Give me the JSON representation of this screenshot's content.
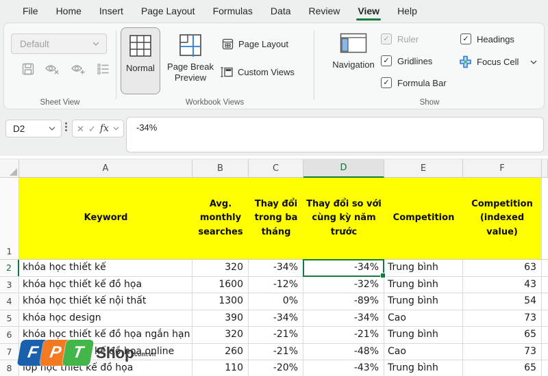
{
  "tabs": [
    {
      "label": "File"
    },
    {
      "label": "Home"
    },
    {
      "label": "Insert"
    },
    {
      "label": "Page Layout"
    },
    {
      "label": "Formulas"
    },
    {
      "label": "Data"
    },
    {
      "label": "Review"
    },
    {
      "label": "View"
    },
    {
      "label": "Help"
    }
  ],
  "active_tab": "View",
  "ribbon": {
    "sheet_view": {
      "label": "Sheet View",
      "dropdown_value": "Default"
    },
    "workbook_views": {
      "label": "Workbook Views",
      "normal": "Normal",
      "page_break_preview": "Page Break Preview",
      "page_layout": "Page Layout",
      "custom_views": "Custom Views"
    },
    "navigation": {
      "label": "Navigation"
    },
    "show": {
      "label": "Show",
      "ruler": "Ruler",
      "gridlines": "Gridlines",
      "formula_bar": "Formula Bar",
      "headings": "Headings",
      "focus_cell": "Focus Cell"
    }
  },
  "formula_bar": {
    "name_box": "D2",
    "value": "-34%"
  },
  "icons": {
    "cancel": "✕",
    "check": "✓",
    "fx": "fx"
  },
  "sheet": {
    "column_letters": [
      "A",
      "B",
      "C",
      "D",
      "E",
      "F"
    ],
    "selected_cell": "D2",
    "selected_column": "D",
    "selected_row": 2,
    "header_fill_color": "#FFFF00",
    "accent_color": "#107C41",
    "headers": [
      "Keyword",
      "Avg. monthly searches",
      "Thay đổi trong ba tháng",
      "Thay đổi so với cùng kỳ năm trước",
      "Competition",
      "Competition (indexed value)"
    ],
    "rows": [
      {
        "num": 2,
        "cells": [
          "khóa học thiết kế",
          "320",
          "-34%",
          "-34%",
          "Trung bình",
          "63"
        ]
      },
      {
        "num": 3,
        "cells": [
          "khóa học thiết kế đồ họa",
          "1600",
          "-12%",
          "-32%",
          "Trung bình",
          "43"
        ]
      },
      {
        "num": 4,
        "cells": [
          "khóa học thiết kế nội thất",
          "1300",
          "0%",
          "-89%",
          "Trung bình",
          "54"
        ]
      },
      {
        "num": 5,
        "cells": [
          "khóa học design",
          "390",
          "-34%",
          "-34%",
          "Cao",
          "73"
        ]
      },
      {
        "num": 6,
        "cells": [
          "khóa học thiết kế đồ họa ngắn hạn",
          "320",
          "-21%",
          "-21%",
          "Trung bình",
          "65"
        ]
      },
      {
        "num": 7,
        "cells": [
          "khóa học thiết kế đồ họa online",
          "260",
          "-21%",
          "-48%",
          "Cao",
          "73"
        ]
      },
      {
        "num": 8,
        "cells": [
          "lớp học thiết kế đồ họa",
          "110",
          "-20%",
          "-43%",
          "Trung bình",
          "65"
        ]
      }
    ]
  },
  "watermark": {
    "f": "F",
    "p": "P",
    "t": "T",
    "shop": "Shop",
    "suffix": ".com.vn",
    "registered": "®",
    "colors": {
      "f": "#1961ac",
      "p": "#f47920",
      "t": "#44b549"
    }
  }
}
